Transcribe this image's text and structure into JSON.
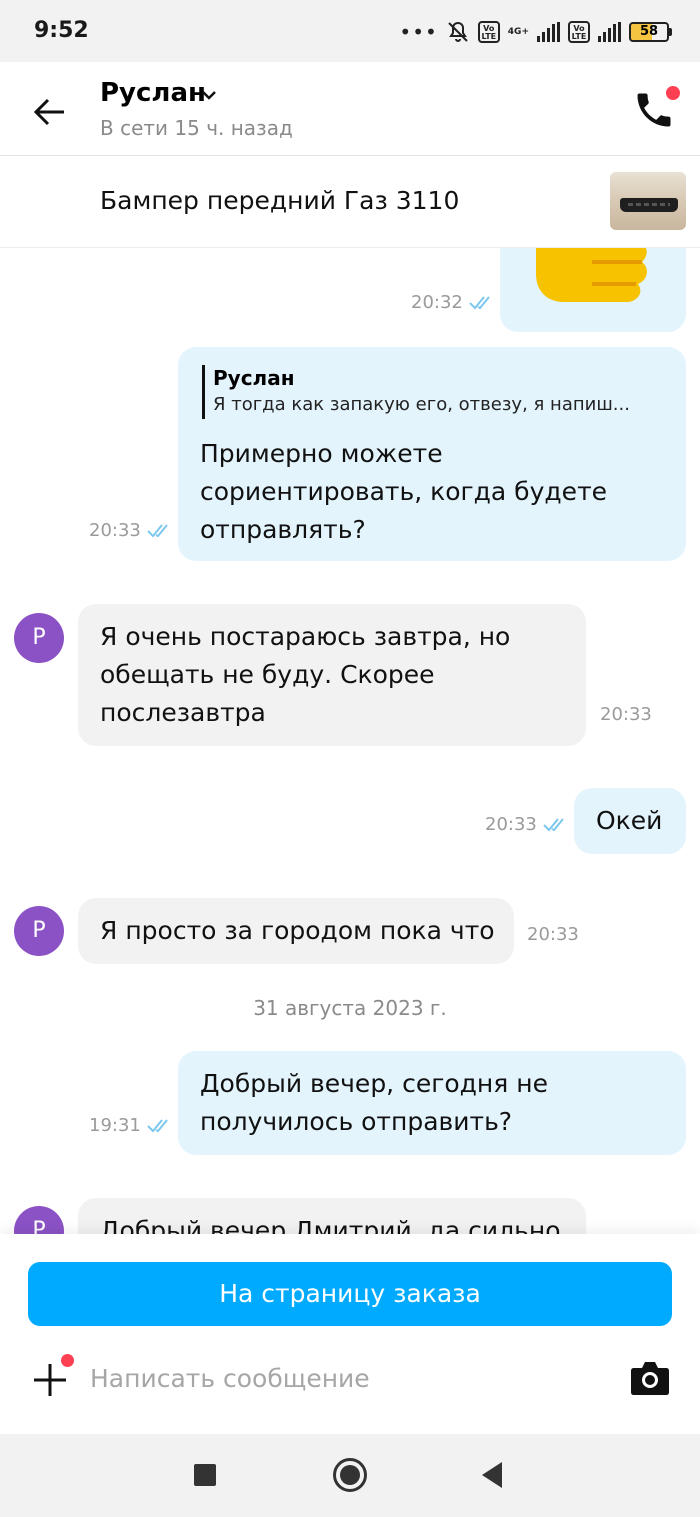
{
  "status_bar": {
    "time": "9:52",
    "battery": "58",
    "network": "4G+",
    "lte_label": "Vo LTE"
  },
  "header": {
    "contact_name": "Руслан",
    "contact_status": "В сети 15 ч. назад"
  },
  "product": {
    "title": "Бампер передний Газ 3110"
  },
  "messages": {
    "m1": {
      "time": "20:32",
      "direction": "outgoing",
      "content": "thumbs-up emoji"
    },
    "m2": {
      "time": "20:33",
      "direction": "outgoing",
      "quote_author": "Руслан",
      "quote_text": "Я тогда как запакую его, отвезу, я напиш...",
      "line1": "Примерно можете",
      "line2": "сориентировать, когда будете",
      "line3": "отправлять?"
    },
    "m3": {
      "time": "20:33",
      "direction": "incoming",
      "avatar": "Р",
      "line1": "Я очень постараюсь завтра, но",
      "line2": "обещать не буду. Скорее",
      "line3": "послезавтра"
    },
    "m4": {
      "time": "20:33",
      "direction": "outgoing",
      "text": "Окей"
    },
    "m5": {
      "time": "20:33",
      "direction": "incoming",
      "avatar": "Р",
      "text": "Я просто за городом пока что"
    },
    "date_separator": "31 августа 2023 г.",
    "m6": {
      "time": "19:31",
      "direction": "outgoing",
      "line1": "Добрый вечер, сегодня не",
      "line2": "получилось отправить?"
    },
    "m7": {
      "direction": "incoming",
      "avatar": "Р",
      "text_partial": "Добрый вечер Дмитрий, да сильно"
    }
  },
  "bottom": {
    "order_button": "На страницу заказа",
    "message_placeholder": "Написать сообщение"
  },
  "colors": {
    "accent": "#00aaff",
    "outgoing_bubble": "#e3f4fd",
    "incoming_bubble": "#f2f2f2",
    "avatar": "#8b52c5",
    "notification_dot": "#ff4053",
    "read_ticks": "#7cc7ee"
  }
}
